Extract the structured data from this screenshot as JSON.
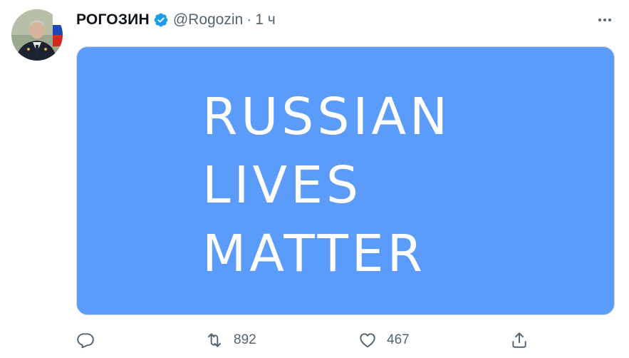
{
  "author": {
    "display_name": "РОГОЗИН",
    "handle": "@Rogozin",
    "separator": "·",
    "time": "1 ч",
    "avatar_icon": "avatar-photo",
    "verified_icon": "verified-badge-icon"
  },
  "media": {
    "background": "#5b9bf9",
    "lines": [
      "RUSSIAN",
      "LIVES",
      "MATTER"
    ]
  },
  "actions": {
    "reply": {
      "icon": "reply-icon",
      "count": ""
    },
    "retweet": {
      "icon": "retweet-icon",
      "count": "892"
    },
    "like": {
      "icon": "heart-icon",
      "count": "467"
    },
    "share": {
      "icon": "share-icon"
    }
  },
  "colors": {
    "accent": "#1d9bf0",
    "muted": "#536471",
    "text": "#0f1419"
  }
}
